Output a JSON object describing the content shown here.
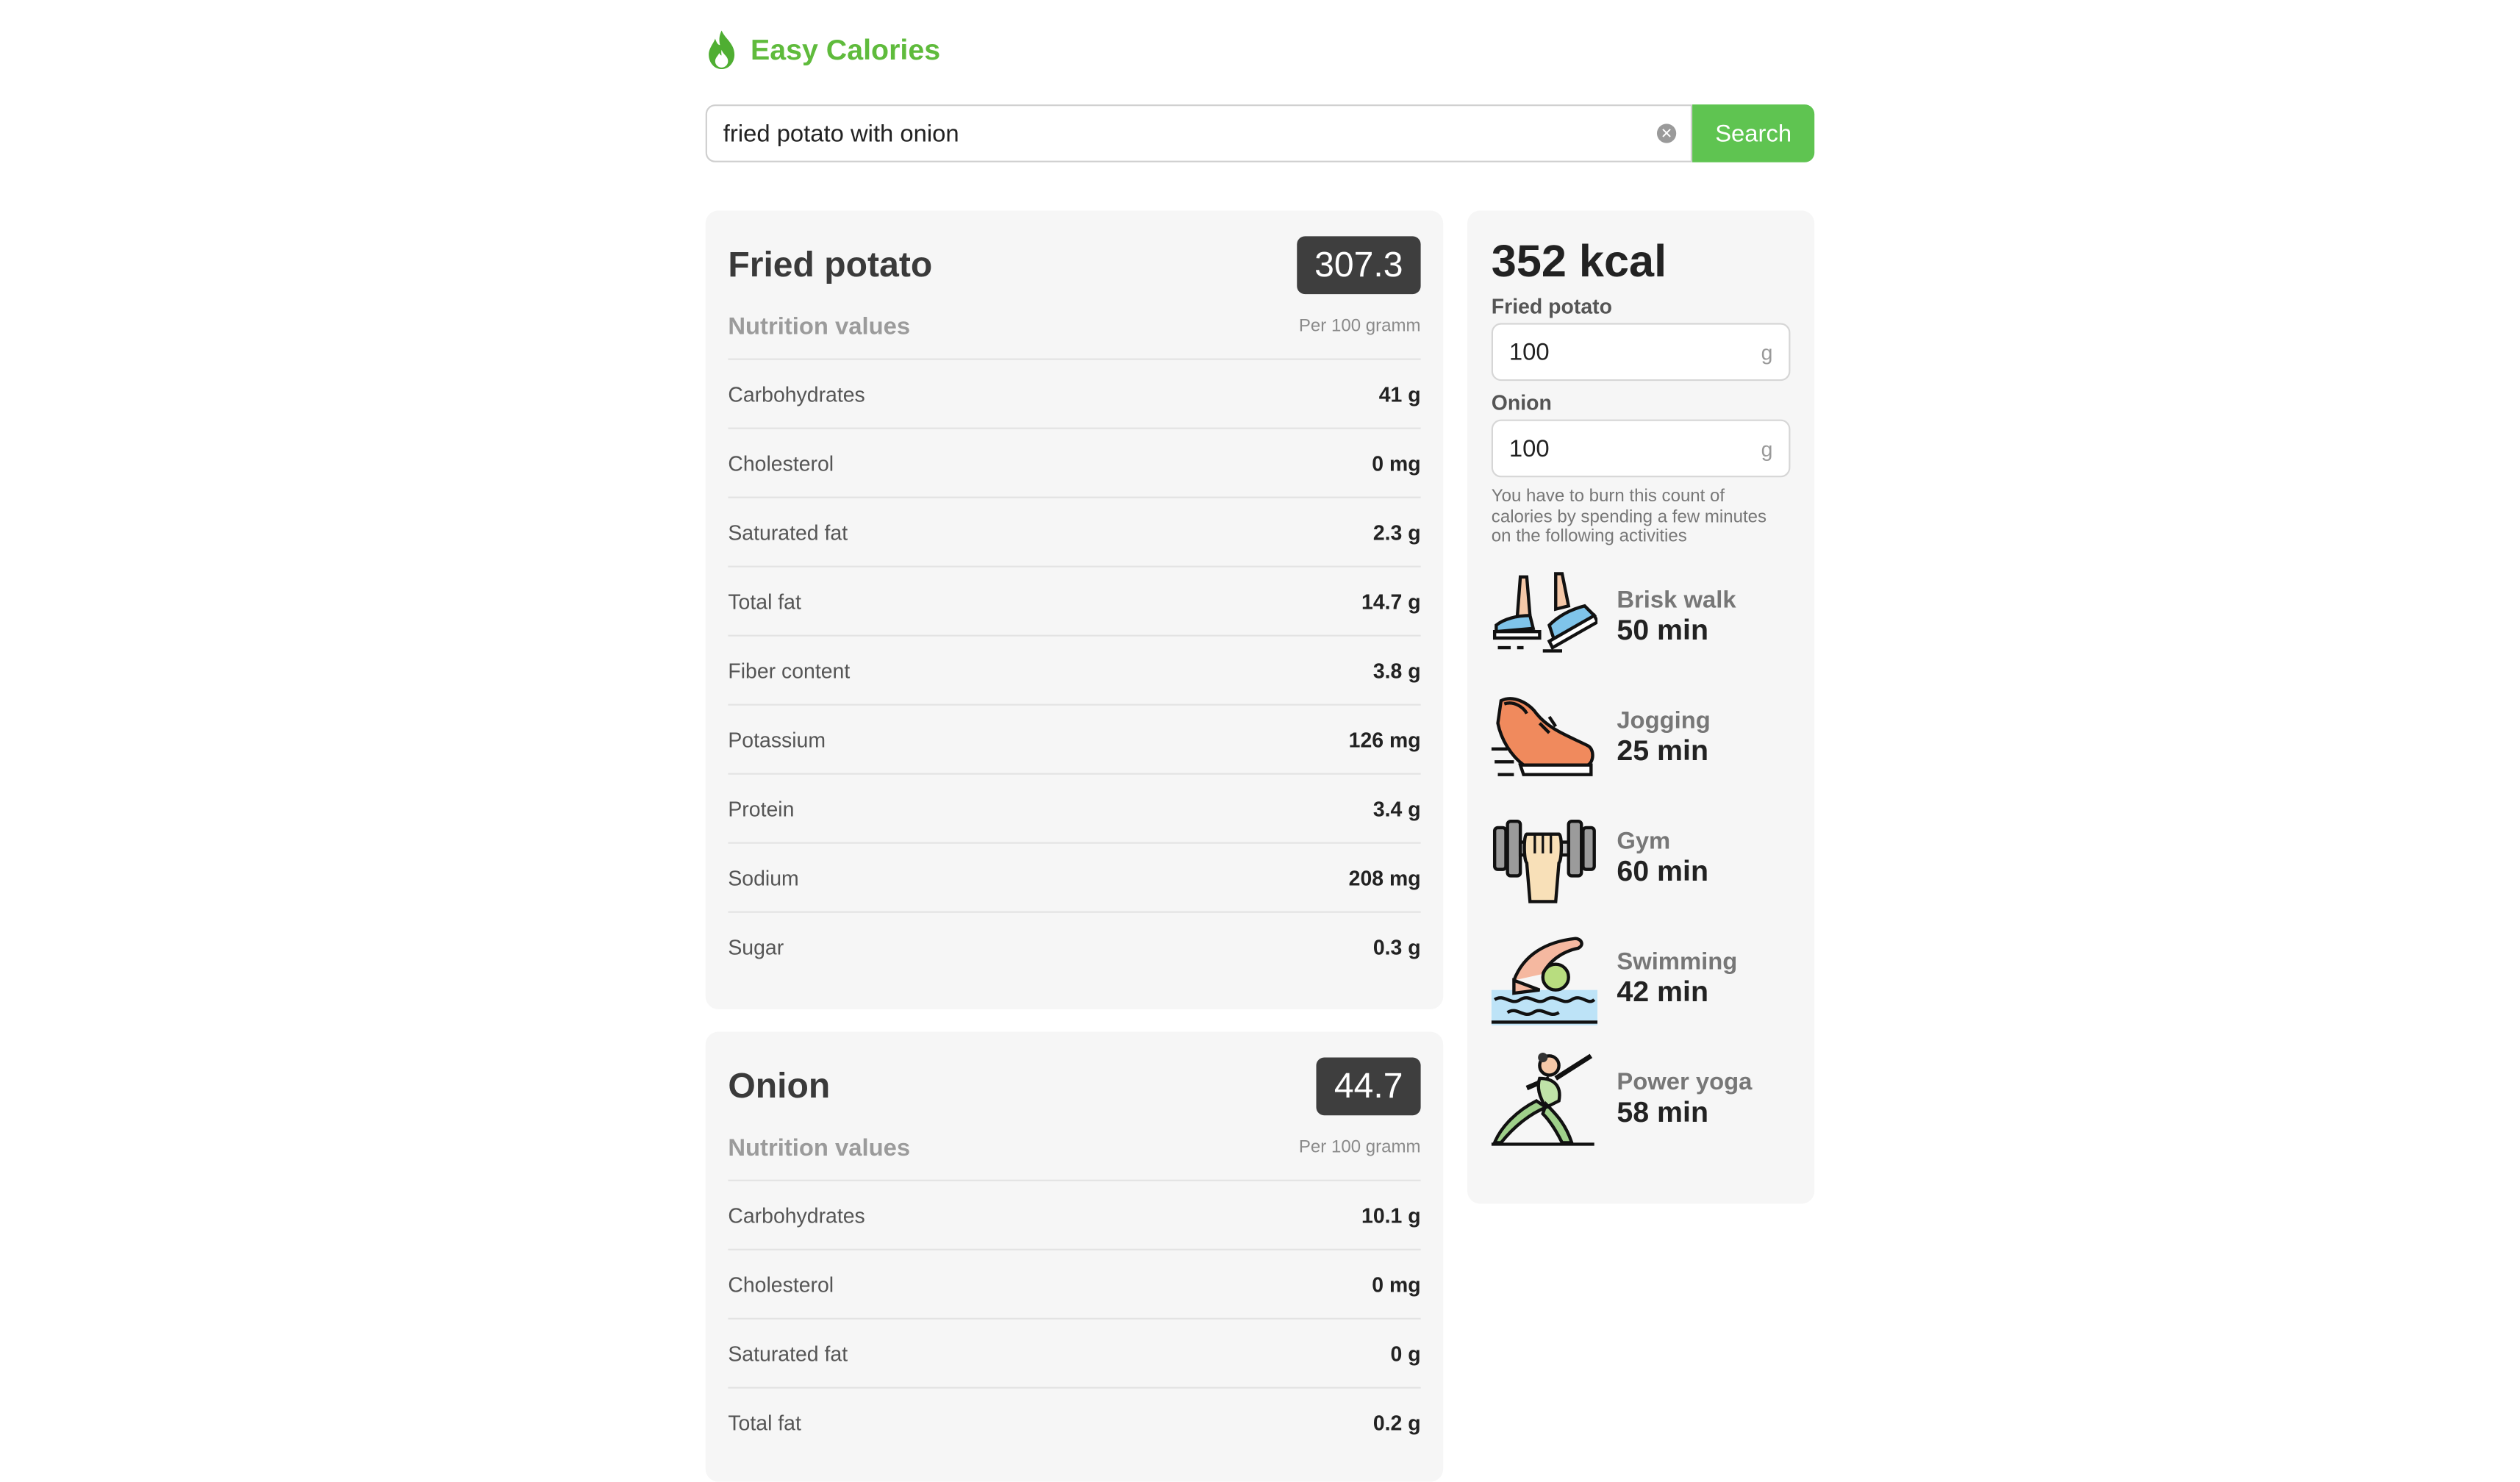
{
  "app": {
    "brand": "Easy Calories",
    "logo_icon": "flame-icon",
    "accent": "#5fbb3c"
  },
  "search": {
    "value": "fried potato with onion",
    "button_label": "Search"
  },
  "foods": [
    {
      "name": "Fried potato",
      "calories": "307.3",
      "section_title": "Nutrition values",
      "per_label": "Per 100 gramm",
      "nutrients": [
        {
          "name": "Carbohydrates",
          "value": "41 g"
        },
        {
          "name": "Cholesterol",
          "value": "0 mg"
        },
        {
          "name": "Saturated fat",
          "value": "2.3 g"
        },
        {
          "name": "Total fat",
          "value": "14.7 g"
        },
        {
          "name": "Fiber content",
          "value": "3.8 g"
        },
        {
          "name": "Potassium",
          "value": "126 mg"
        },
        {
          "name": "Protein",
          "value": "3.4 g"
        },
        {
          "name": "Sodium",
          "value": "208 mg"
        },
        {
          "name": "Sugar",
          "value": "0.3 g"
        }
      ]
    },
    {
      "name": "Onion",
      "calories": "44.7",
      "section_title": "Nutrition values",
      "per_label": "Per 100 gramm",
      "nutrients": [
        {
          "name": "Carbohydrates",
          "value": "10.1 g"
        },
        {
          "name": "Cholesterol",
          "value": "0 mg"
        },
        {
          "name": "Saturated fat",
          "value": "0 g"
        },
        {
          "name": "Total fat",
          "value": "0.2 g"
        }
      ]
    }
  ],
  "summary": {
    "total": "352 kcal",
    "quantities": [
      {
        "label": "Fried potato",
        "value": "100",
        "unit": "g"
      },
      {
        "label": "Onion",
        "value": "100",
        "unit": "g"
      }
    ],
    "burn_note": "You have to burn this count of calories by spending a few minutes on the following activities",
    "activities": [
      {
        "name": "Brisk walk",
        "time": "50 min",
        "icon": "sneakers-icon"
      },
      {
        "name": "Jogging",
        "time": "25 min",
        "icon": "running-shoe-icon"
      },
      {
        "name": "Gym",
        "time": "60 min",
        "icon": "dumbbell-icon"
      },
      {
        "name": "Swimming",
        "time": "42 min",
        "icon": "swimmer-icon"
      },
      {
        "name": "Power yoga",
        "time": "58 min",
        "icon": "yoga-pose-icon"
      }
    ]
  }
}
